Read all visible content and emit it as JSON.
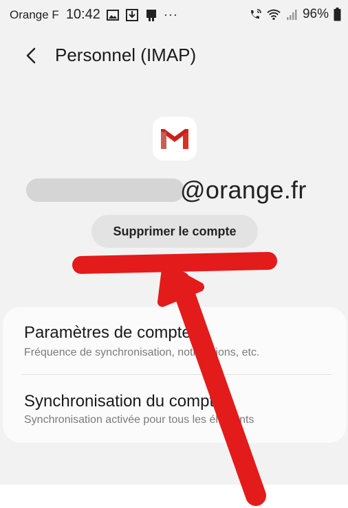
{
  "status_bar": {
    "carrier": "Orange F",
    "time": "10:42",
    "more": "···",
    "battery": "96%"
  },
  "header": {
    "title": "Personnel (IMAP)"
  },
  "account": {
    "email_domain": "@orange.fr",
    "delete_button": "Supprimer le compte"
  },
  "settings": [
    {
      "title": "Paramètres de compte",
      "subtitle": "Fréquence de synchronisation, notifications, etc."
    },
    {
      "title": "Synchronisation du compte",
      "subtitle": "Synchronisation activée pour tous les éléments"
    }
  ],
  "colors": {
    "annotation": "#e31b1b",
    "gmail_red": "#d93025"
  }
}
